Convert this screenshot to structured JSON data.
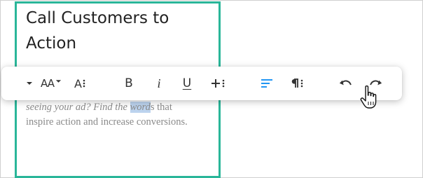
{
  "editor": {
    "heading": "Call Customers to Action",
    "body_italic": "seeing your ad? Find the ",
    "body_highlight": "word",
    "body_after_highlight": "s that",
    "body_rest": "inspire action and increase conversions."
  },
  "toolbar": {
    "font_size_label": "AA",
    "text_style_label": "A",
    "bold_label": "B",
    "italic_label": "i",
    "underline_label": "U",
    "accent_color": "#2196f3",
    "block_border_color": "#2ab699",
    "highlight_color": "#bcd3ee"
  }
}
